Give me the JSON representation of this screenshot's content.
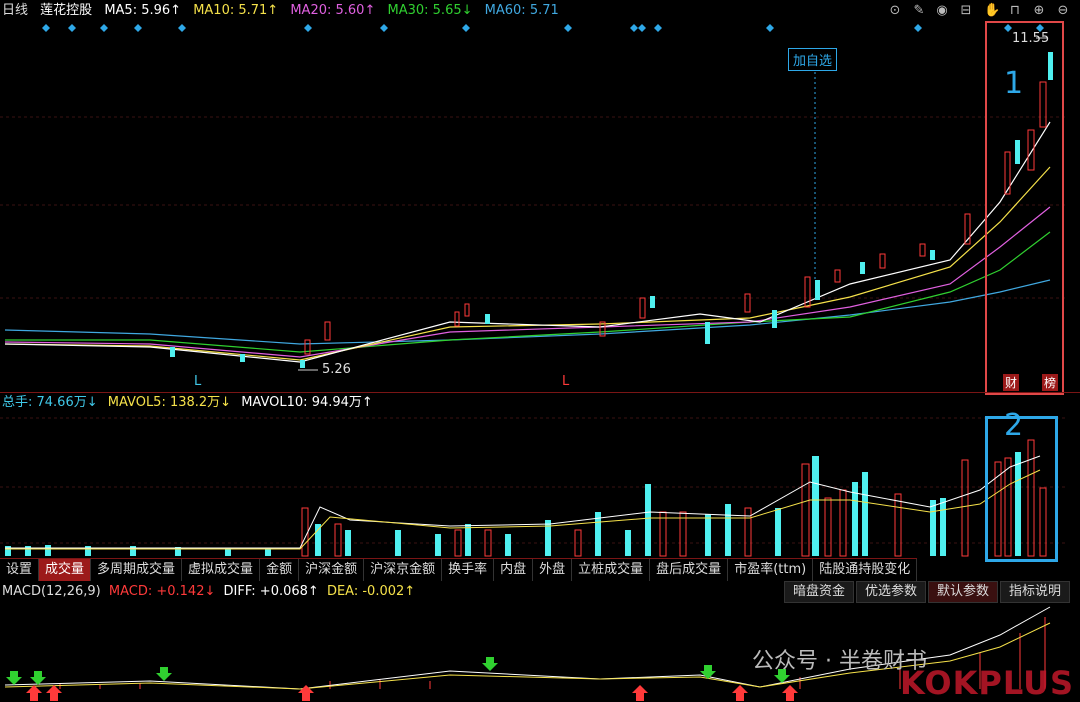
{
  "header": {
    "period": "日线",
    "stock_name": "莲花控股",
    "ma5": "MA5: 5.96↑",
    "ma10": "MA10: 5.71↑",
    "ma20": "MA20: 5.60↑",
    "ma30": "MA30: 5.65↓",
    "ma60": "MA60: 5.71"
  },
  "colors": {
    "ma5": "#ffffff",
    "ma10": "#f5e14a",
    "ma20": "#e060e0",
    "ma30": "#30d030",
    "ma60": "#40a8e0",
    "up": "#ff3a3a",
    "down": "#4ff0f0",
    "accent_red": "#e04848",
    "accent_blue": "#2ea8e8"
  },
  "toolbar_icons": [
    "target-icon",
    "pen-icon",
    "eye-icon",
    "basket-icon",
    "hand-icon",
    "lock-icon",
    "zoom-in-icon",
    "zoom-out-icon"
  ],
  "chart_annotations": {
    "high_label": "11.55",
    "low_label": "5.26",
    "add_watch": "加自选",
    "l_marker_1": "L",
    "l_marker_2": "L",
    "cai_label": "财",
    "bang_label": "榜"
  },
  "highlights": {
    "box1_number": "1",
    "box2_number": "2"
  },
  "volume": {
    "total": "总手: 74.66万↓",
    "mavol5": "MAVOL5: 138.2万↓",
    "mavol10": "MAVOL10: 94.94万↑"
  },
  "tabs": [
    "设置",
    "成交量",
    "多周期成交量",
    "虚拟成交量",
    "金额",
    "沪深金额",
    "沪深京金额",
    "换手率",
    "内盘",
    "外盘",
    "立桩成交量",
    "盘后成交量",
    "市盈率(ttm)",
    "陆股通持股变化"
  ],
  "active_tab": "成交量",
  "macd": {
    "name": "MACD(12,26,9)",
    "macd_val": "MACD: +0.142↓",
    "diff_val": "DIFF: +0.068↑",
    "dea_val": "DEA: -0.002↑"
  },
  "macd_buttons": [
    "暗盘资金",
    "优选参数",
    "默认参数",
    "指标说明"
  ],
  "watermark": "公众号 · 半卷财书",
  "brand": "KOKPLUS"
}
